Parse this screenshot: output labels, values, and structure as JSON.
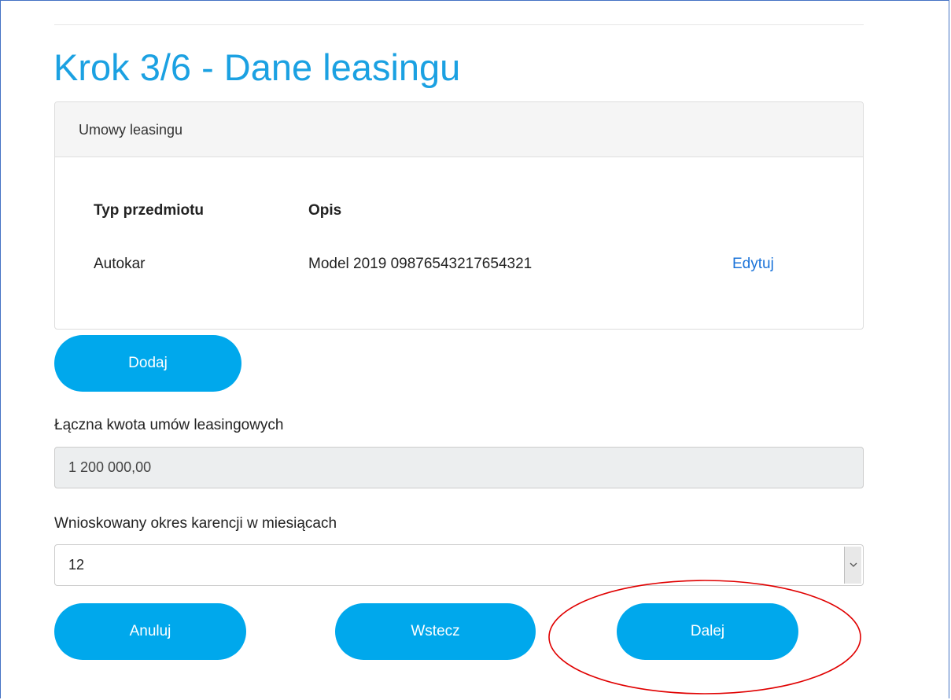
{
  "page": {
    "title": "Krok 3/6 - Dane leasingu"
  },
  "lease_panel": {
    "heading": "Umowy leasingu",
    "columns": [
      "Typ przedmiotu",
      "Opis"
    ],
    "rows": [
      {
        "type": "Autokar",
        "description": "Model 2019 09876543217654321",
        "edit_label": "Edytuj"
      }
    ]
  },
  "add_button": {
    "label": "Dodaj"
  },
  "total_amount": {
    "label": "Łączna kwota umów leasingowych",
    "value": "1 200 000,00"
  },
  "grace_period": {
    "label": "Wnioskowany okres karencji w miesiącach",
    "selected_value": "12"
  },
  "footer_buttons": {
    "cancel_label": "Anuluj",
    "back_label": "Wstecz",
    "next_label": "Dalej"
  },
  "colors": {
    "title": "#1ba1e2",
    "button": "#00a8ec",
    "link": "#1a73d9",
    "highlight": "#e00000"
  },
  "icons": {
    "select_arrow": "chevron-down-icon"
  }
}
